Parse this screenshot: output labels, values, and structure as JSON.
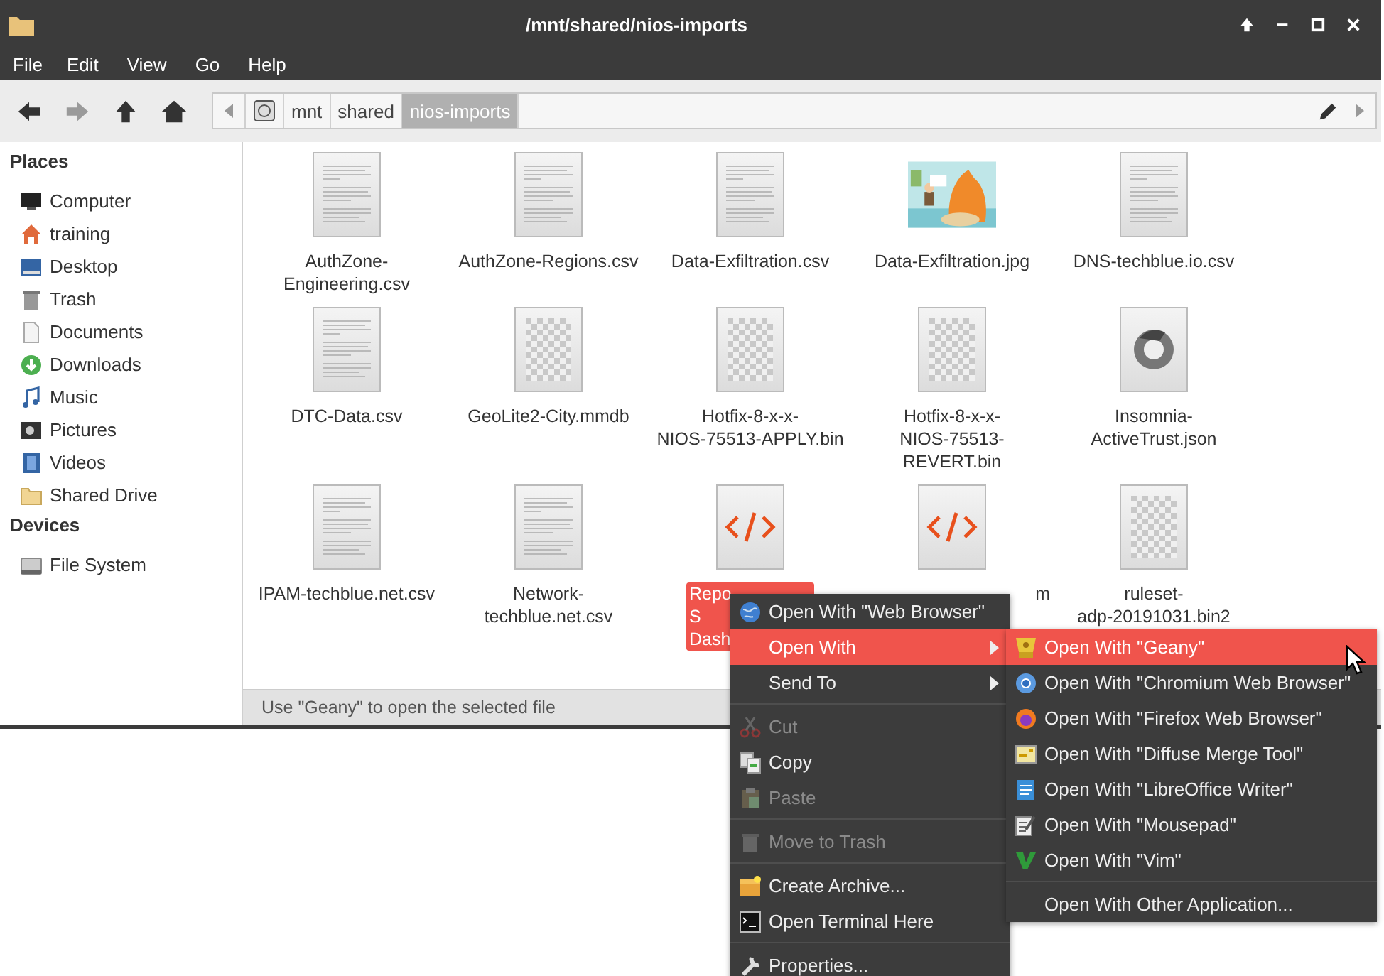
{
  "window": {
    "title": "/mnt/shared/nios-imports"
  },
  "menubar": [
    "File",
    "Edit",
    "View",
    "Go",
    "Help"
  ],
  "navigation": [
    {
      "disabled": false
    },
    {
      "disabled": true
    },
    {
      "disabled": false
    },
    {
      "disabled": false
    }
  ],
  "path_bar": {
    "segments": [
      {
        "label": "mnt",
        "selected": false
      },
      {
        "label": "shared",
        "selected": false
      },
      {
        "label": "nios-imports",
        "selected": true
      }
    ]
  },
  "sidebar": {
    "sections": [
      {
        "title": "Places",
        "items": [
          {
            "label": "Computer"
          },
          {
            "label": "training"
          },
          {
            "label": "Desktop"
          },
          {
            "label": "Trash"
          },
          {
            "label": "Documents"
          },
          {
            "label": "Downloads"
          },
          {
            "label": "Music"
          },
          {
            "label": "Pictures"
          },
          {
            "label": "Videos"
          },
          {
            "label": "Shared Drive"
          }
        ]
      },
      {
        "title": "Devices",
        "items": [
          {
            "label": "File System"
          }
        ]
      }
    ]
  },
  "files": [
    {
      "kind": "text",
      "lines": [
        "AuthZone-",
        "Engineering.csv"
      ],
      "selected": false
    },
    {
      "kind": "text",
      "lines": [
        "AuthZone-Regions.csv"
      ],
      "selected": false
    },
    {
      "kind": "text",
      "lines": [
        "Data-Exfiltration.csv"
      ],
      "selected": false
    },
    {
      "lines": [
        "Data-Exfiltration.jpg"
      ],
      "selected": false
    },
    {
      "kind": "text",
      "lines": [
        "DNS-techblue.io.csv"
      ],
      "selected": false
    },
    {
      "kind": "text",
      "lines": [
        "DTC-Data.csv"
      ],
      "selected": false
    },
    {
      "kind": "binary",
      "lines": [
        "GeoLite2-City.mmdb"
      ],
      "selected": false
    },
    {
      "kind": "binary",
      "lines": [
        "Hotfix-8-x-x-",
        "NIOS-75513-APPLY.bin"
      ],
      "selected": false
    },
    {
      "kind": "binary",
      "lines": [
        "Hotfix-8-x-x-",
        "NIOS-75513-",
        "REVERT.bin"
      ],
      "selected": false
    },
    {
      "kind": "json",
      "lines": [
        "Insomnia-",
        "ActiveTrust.json"
      ],
      "selected": false
    },
    {
      "kind": "text",
      "lines": [
        "IPAM-techblue.net.csv"
      ],
      "selected": false
    },
    {
      "kind": "text",
      "lines": [
        "Network-",
        "techblue.net.csv"
      ],
      "selected": false
    },
    {
      "kind": "code",
      "lines": [
        "Repo",
        "S",
        "Dash"
      ],
      "selected": true
    },
    {
      "kind": "code",
      "lines": [
        "m"
      ],
      "selected": false
    },
    {
      "kind": "binary",
      "lines": [
        "ruleset-",
        "adp-20191031.bin2"
      ],
      "selected": false
    }
  ],
  "status_bar": "Use \"Geany\" to open the selected file",
  "context_menu": {
    "groups": [
      [
        {
          "label": "Open With \"Web Browser\"",
          "disabled": false,
          "selected": false,
          "submenu": false
        },
        {
          "label": "Open With",
          "disabled": false,
          "selected": true,
          "submenu": true
        },
        {
          "label": "Send To",
          "disabled": false,
          "selected": false,
          "submenu": true
        }
      ],
      [
        {
          "label": "Cut",
          "disabled": true,
          "selected": false,
          "submenu": false
        },
        {
          "label": "Copy",
          "disabled": false,
          "selected": false,
          "submenu": false
        },
        {
          "label": "Paste",
          "disabled": true,
          "selected": false,
          "submenu": false
        }
      ],
      [
        {
          "label": "Move to Trash",
          "disabled": true,
          "selected": false,
          "submenu": false
        }
      ],
      [
        {
          "label": "Create Archive...",
          "disabled": false,
          "selected": false,
          "submenu": false
        },
        {
          "label": "Open Terminal Here",
          "disabled": false,
          "selected": false,
          "submenu": false
        }
      ],
      [
        {
          "label": "Properties...",
          "disabled": false,
          "selected": false,
          "submenu": false
        }
      ]
    ]
  },
  "submenu": {
    "groups": [
      [
        {
          "label": "Open With \"Geany\"",
          "selected": true
        },
        {
          "label": "Open With \"Chromium Web Browser\"",
          "selected": false
        },
        {
          "label": "Open With \"Firefox Web Browser\"",
          "selected": false
        },
        {
          "label": "Open With \"Diffuse Merge Tool\"",
          "selected": false
        },
        {
          "label": "Open With \"LibreOffice Writer\"",
          "selected": false
        },
        {
          "label": "Open With \"Mousepad\"",
          "selected": false
        },
        {
          "label": "Open With \"Vim\"",
          "selected": false
        }
      ],
      [
        {
          "label": "Open With Other Application...",
          "selected": false
        }
      ]
    ]
  }
}
